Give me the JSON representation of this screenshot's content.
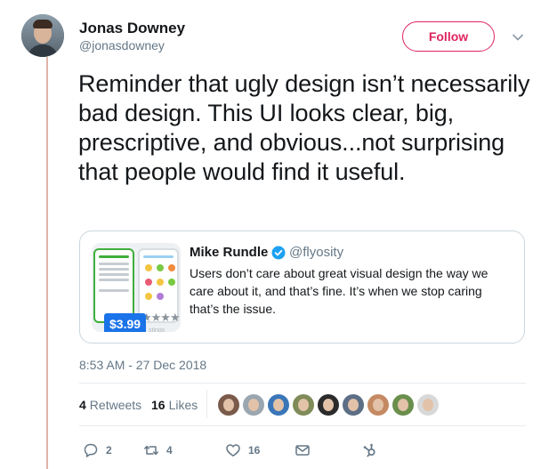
{
  "author": {
    "name": "Jonas Downey",
    "handle": "@jonasdowney"
  },
  "follow_label": "Follow",
  "tweet": {
    "text": "Reminder that ugly design isn’t necessarily bad design. This UI looks clear, big, prescriptive, and obvious...not surprising that people would find it useful.",
    "timestamp": "8:53 AM - 27 Dec 2018"
  },
  "quoted": {
    "name": "Mike Rundle",
    "handle": "@flyosity",
    "text": "Users don’t care about great visual design the way we care about it, and that’s fine. It’s when we stop caring that’s the issue.",
    "thumbnail": {
      "price": "$3.99",
      "stars": "★★★★",
      "sub": "stings"
    }
  },
  "stats": {
    "retweets_count": "4",
    "retweets_label": "Retweets",
    "likes_count": "16",
    "likes_label": "Likes"
  },
  "actions": {
    "replies": "2",
    "retweets": "4",
    "likes": "16"
  },
  "colors": {
    "accent": "#e0245e",
    "secondary_text": "#657786",
    "verified": "#1da1f2",
    "price_badge": "#1a73e8"
  }
}
